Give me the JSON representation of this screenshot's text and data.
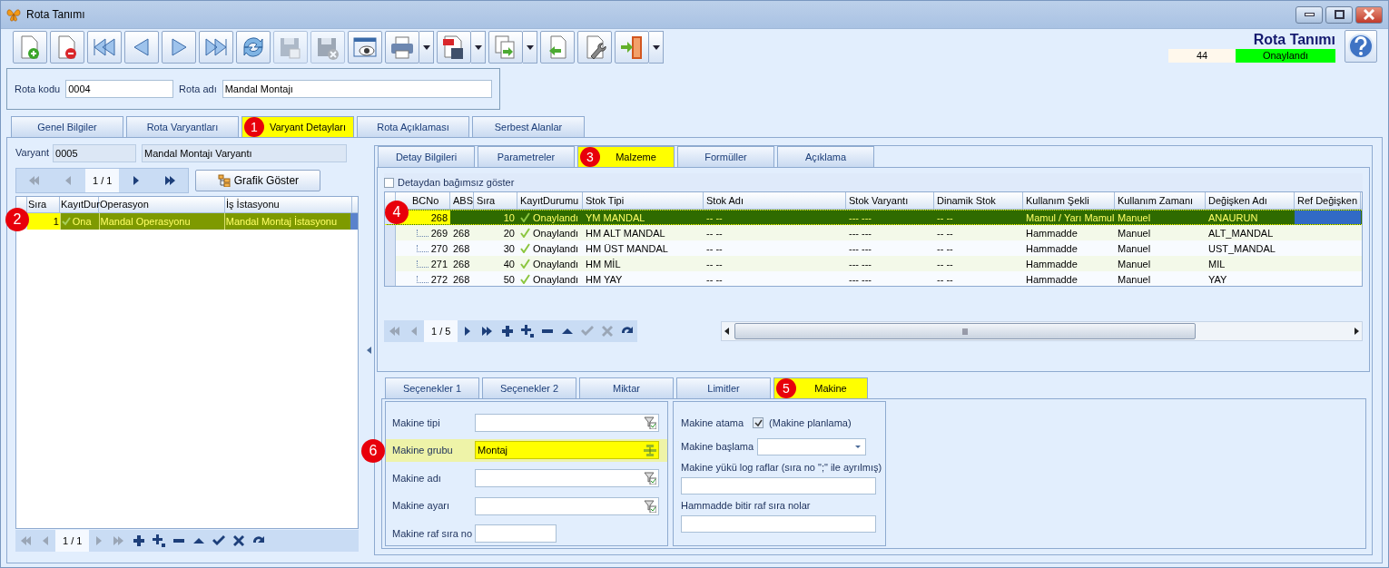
{
  "window": {
    "title": "Rota Tanımı"
  },
  "toolbar": [
    {
      "kind": "new",
      "disabled": false,
      "dropdown": false
    },
    {
      "kind": "delete",
      "disabled": false,
      "dropdown": false
    },
    {
      "kind": "first",
      "disabled": false,
      "dropdown": false
    },
    {
      "kind": "prev",
      "disabled": false,
      "dropdown": false
    },
    {
      "kind": "next",
      "disabled": false,
      "dropdown": false
    },
    {
      "kind": "last",
      "disabled": false,
      "dropdown": false
    },
    {
      "kind": "refresh",
      "disabled": false,
      "dropdown": false
    },
    {
      "kind": "save",
      "disabled": true,
      "dropdown": false
    },
    {
      "kind": "cancel",
      "disabled": true,
      "dropdown": false
    },
    {
      "kind": "preview",
      "disabled": false,
      "dropdown": false
    },
    {
      "kind": "print",
      "disabled": false,
      "dropdown": true
    },
    {
      "kind": "pdf",
      "disabled": false,
      "dropdown": true
    },
    {
      "kind": "export",
      "disabled": false,
      "dropdown": true
    },
    {
      "kind": "import",
      "disabled": false,
      "dropdown": false
    },
    {
      "kind": "tools",
      "disabled": false,
      "dropdown": false
    },
    {
      "kind": "exit",
      "disabled": false,
      "dropdown": true
    }
  ],
  "header": {
    "title": "Rota Tanımı",
    "number": "44",
    "status": "Onaylandı"
  },
  "form": [
    {
      "label": "Rota kodu",
      "value": "0004"
    },
    {
      "label": "Rota adı",
      "value": "Mandal Montajı"
    }
  ],
  "main_tabs": [
    {
      "label": "Genel Bilgiler",
      "selected": false
    },
    {
      "label": "Rota Varyantları",
      "selected": false
    },
    {
      "label": "Varyant Detayları",
      "selected": true,
      "callout": "1"
    },
    {
      "label": "Rota Açıklaması",
      "selected": false
    },
    {
      "label": "Serbest Alanlar",
      "selected": false
    }
  ],
  "variant": {
    "label": "Varyant",
    "code": "0005",
    "name": "Mandal Montajı Varyantı"
  },
  "left_navigator": {
    "position": "1 / 1",
    "buttons": [
      {
        "kind": "first",
        "disabled": true
      },
      {
        "kind": "prev",
        "disabled": true
      },
      {
        "kind": "next",
        "disabled": false
      },
      {
        "kind": "last",
        "disabled": false
      }
    ]
  },
  "graph_button": {
    "label": "Grafik Göster"
  },
  "operations": {
    "columns": [
      "Sıra",
      "KayıtDur",
      "Operasyon",
      "İş İstasyonu"
    ],
    "rows": [
      {
        "cells": [
          "1",
          "Ona",
          "Mandal Operasyonu",
          "Mandal Montaj İstasyonu"
        ],
        "selected": true,
        "callout": "2"
      }
    ]
  },
  "left_footer": {
    "position": "1 / 1",
    "buttons": [
      {
        "kind": "first",
        "disabled": true
      },
      {
        "kind": "prev",
        "disabled": true
      },
      {
        "kind": "next",
        "disabled": true
      },
      {
        "kind": "last",
        "disabled": true
      },
      {
        "kind": "add",
        "disabled": false
      },
      {
        "kind": "add-child",
        "disabled": false
      },
      {
        "kind": "remove",
        "disabled": false
      },
      {
        "kind": "up",
        "disabled": false
      },
      {
        "kind": "confirm",
        "disabled": false
      },
      {
        "kind": "discard",
        "disabled": false
      },
      {
        "kind": "redo",
        "disabled": false
      }
    ]
  },
  "detail_tabs": [
    {
      "label": "Detay Bilgileri",
      "selected": false
    },
    {
      "label": "Parametreler",
      "selected": false
    },
    {
      "label": "Malzeme",
      "selected": true,
      "callout": "3"
    },
    {
      "label": "Formüller",
      "selected": false
    },
    {
      "label": "Açıklama",
      "selected": false
    }
  ],
  "independent_checkbox": {
    "label": "Detaydan bağımsız göster",
    "checked": false
  },
  "materials": {
    "columns": [
      "BCNo",
      "ABS",
      "Sıra",
      "KayıtDurumu",
      "Stok Tipi",
      "Stok Adı",
      "Stok Varyantı",
      "Dinamik Stok",
      "Kullanım Şekli",
      "Kullanım Zamanı",
      "Değişken Adı",
      "Ref Değişken"
    ],
    "callout": "4",
    "rows": [
      {
        "cells": [
          "268",
          null,
          "10",
          "Onaylandı",
          "YM MANDAL",
          "-- --",
          "--- ---",
          "-- --",
          "Mamul / Yarı Mamul",
          "Manuel",
          "ANAURUN",
          null
        ],
        "selected": true,
        "children": [
          {
            "cells": [
              "269",
              "268",
              "20",
              "Onaylandı",
              "HM ALT MANDAL",
              "-- --",
              "--- ---",
              "-- --",
              "Hammadde",
              "Manuel",
              "ALT_MANDAL",
              null
            ],
            "selected": false
          },
          {
            "cells": [
              "270",
              "268",
              "30",
              "Onaylandı",
              "HM ÜST MANDAL",
              "-- --",
              "--- ---",
              "-- --",
              "Hammadde",
              "Manuel",
              "UST_MANDAL",
              null
            ],
            "selected": false
          },
          {
            "cells": [
              "271",
              "268",
              "40",
              "Onaylandı",
              "HM MİL",
              "-- --",
              "--- ---",
              "-- --",
              "Hammadde",
              "Manuel",
              "MIL",
              null
            ],
            "selected": false
          },
          {
            "cells": [
              "272",
              "268",
              "50",
              "Onaylandı",
              "HM YAY",
              "-- --",
              "--- ---",
              "-- --",
              "Hammadde",
              "Manuel",
              "YAY",
              null
            ],
            "selected": false
          }
        ]
      }
    ]
  },
  "materials_navigator": {
    "position": "1 / 5",
    "buttons": [
      {
        "kind": "first",
        "disabled": true
      },
      {
        "kind": "prev",
        "disabled": true
      },
      {
        "kind": "next",
        "disabled": false
      },
      {
        "kind": "last",
        "disabled": false
      },
      {
        "kind": "add",
        "disabled": false
      },
      {
        "kind": "add-child",
        "disabled": false
      },
      {
        "kind": "remove",
        "disabled": false
      },
      {
        "kind": "up",
        "disabled": false
      },
      {
        "kind": "confirm",
        "disabled": true
      },
      {
        "kind": "discard",
        "disabled": true
      },
      {
        "kind": "redo",
        "disabled": false
      }
    ]
  },
  "option_tabs": [
    {
      "label": "Seçenekler 1",
      "selected": false
    },
    {
      "label": "Seçenekler 2",
      "selected": false
    },
    {
      "label": "Miktar",
      "selected": false
    },
    {
      "label": "Limitler",
      "selected": false
    },
    {
      "label": "Makine",
      "selected": true,
      "callout": "5"
    }
  ],
  "machine_fields": [
    {
      "label": "Makine tipi",
      "kind": "lookup",
      "highlighted": false
    },
    {
      "label": "Makine grubu",
      "value": "Montaj",
      "kind": "group",
      "highlighted": true,
      "callout": "6"
    },
    {
      "label": "Makine adı",
      "kind": "lookup",
      "highlighted": false
    },
    {
      "label": "Makine ayarı",
      "kind": "lookup",
      "highlighted": false
    },
    {
      "label": "Makine raf sıra no",
      "kind": "plain",
      "highlighted": false
    }
  ],
  "machine_options": [
    {
      "kind": "checkbox",
      "label": "Makine atama",
      "checked": true,
      "note": "(Makine planlama)"
    },
    {
      "kind": "dropdown",
      "label": "Makine başlama"
    },
    {
      "kind": "text",
      "label": "Makine yükü log raflar (sıra no \";\" ile ayrılmış)"
    },
    {
      "kind": "text",
      "label": "Hammadde bitir raf sıra nolar"
    }
  ]
}
